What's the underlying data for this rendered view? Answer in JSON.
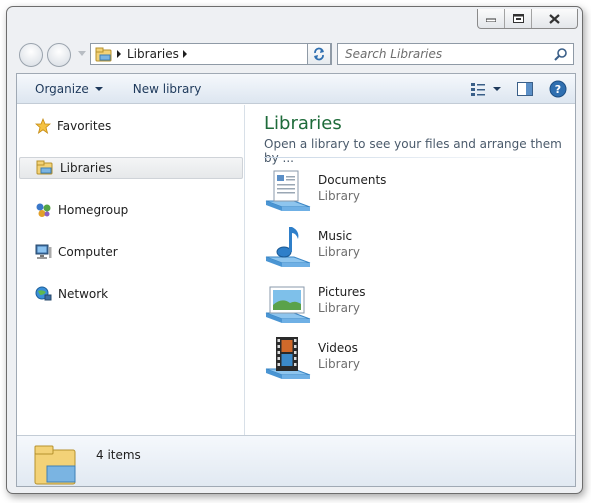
{
  "window": {
    "caption": {
      "minimize": "minimize",
      "maximize": "maximize",
      "close": "close"
    }
  },
  "address": {
    "crumbs": [
      "Libraries"
    ]
  },
  "search": {
    "placeholder": "Search Libraries"
  },
  "toolbar": {
    "organize_label": "Organize",
    "new_library_label": "New library"
  },
  "navpane": {
    "items": [
      {
        "label": "Favorites",
        "icon": "star-icon"
      },
      {
        "label": "Libraries",
        "icon": "libraries-icon"
      },
      {
        "label": "Homegroup",
        "icon": "homegroup-icon"
      },
      {
        "label": "Computer",
        "icon": "computer-icon"
      },
      {
        "label": "Network",
        "icon": "network-icon"
      }
    ]
  },
  "content": {
    "title": "Libraries",
    "subtitle": "Open a library to see your files and arrange them by ...",
    "libraries": [
      {
        "name": "Documents",
        "type": "Library",
        "icon": "documents-icon"
      },
      {
        "name": "Music",
        "type": "Library",
        "icon": "music-icon"
      },
      {
        "name": "Pictures",
        "type": "Library",
        "icon": "pictures-icon"
      },
      {
        "name": "Videos",
        "type": "Library",
        "icon": "videos-icon"
      }
    ]
  },
  "details": {
    "count": "4 items"
  },
  "colors": {
    "accent_title": "#1e6b3a",
    "toolbar_text": "#1e395b",
    "border": "#a0a9b4"
  }
}
